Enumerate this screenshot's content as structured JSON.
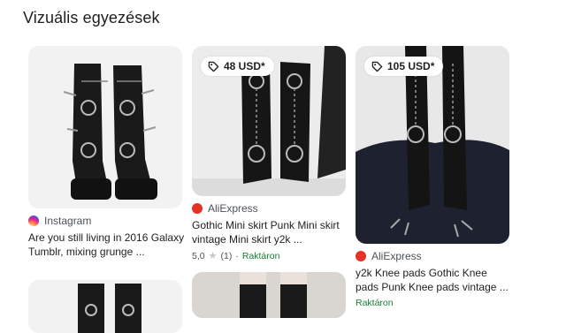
{
  "section": {
    "title": "Vizuális egyezések"
  },
  "results": [
    {
      "source": "Instagram",
      "source_color": "#e1306c",
      "title_line1": "Are you still living in 2016 Galaxy",
      "title_line2": "Tumblr, mixing grunge ...",
      "image_icon": "instagram-icon"
    },
    {
      "price": "48 USD*",
      "source": "AliExpress",
      "source_color": "#e43225",
      "title_line1": "Gothic Mini skirt Punk Mini skirt",
      "title_line2": "vintage Mini skirt y2k ...",
      "rating": "5,0",
      "reviews": "(1)",
      "stock": "Raktáron",
      "image_icon": "aliexpress-icon"
    },
    {
      "price": "105 USD*",
      "source": "AliExpress",
      "source_color": "#e43225",
      "title_line1": "y2k Knee pads Gothic Knee",
      "title_line2": "pads Punk Knee pads vintage ...",
      "stock": "Raktáron",
      "image_icon": "aliexpress-icon"
    }
  ],
  "icons": {
    "price_tag": "tag-icon",
    "star": "star-icon"
  }
}
